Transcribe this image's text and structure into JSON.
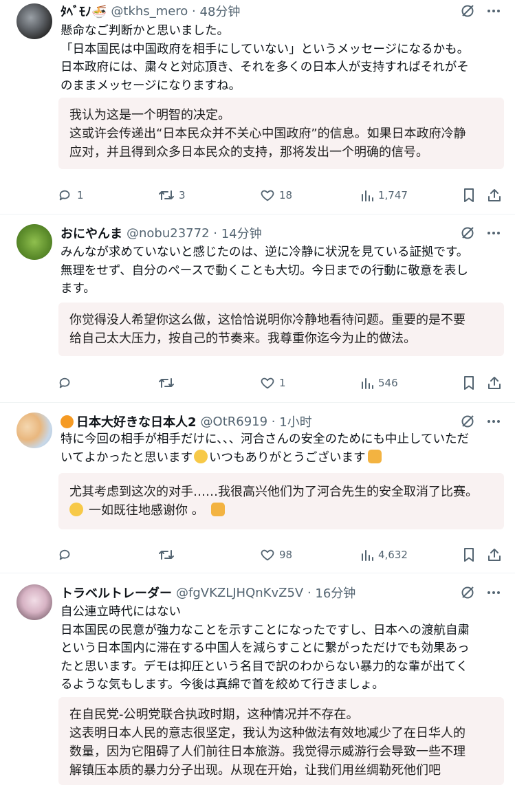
{
  "tweets": [
    {
      "name": "ﾀﾍﾞﾓﾉ🍜",
      "handle": "@tkhs_mero",
      "time": "48分钟",
      "lines": [
        "懸命なご判断かと思いました。",
        "「日本国民は中国政府を相手にしていない」というメッセージになるかも。",
        "日本政府には、粛々と対応頂き、それを多くの日本人が支持すればそれがそ",
        "のままメッセージになりますね。"
      ],
      "translation": [
        "我认为这是一个明智的决定。",
        "这或许会传递出“日本民众并不关心中国政府”的信息。如果日本政府冷静",
        "应对，并且得到众多日本民众的支持，那将发出一个明确的信号。"
      ],
      "replies": "1",
      "retweets": "3",
      "likes": "18",
      "views": "1,747"
    },
    {
      "name": "おにやんま",
      "handle": "@nobu23772",
      "time": "14分钟",
      "lines": [
        "みんなが求めていないと感じたのは、逆に冷静に状況を見ている証拠です。",
        "無理をせず、自分のペースで動くことも大切。今日までの行動に敬意を表し",
        "ます。"
      ],
      "translation": [
        "你觉得没人希望你这么做，这恰恰说明你冷静地看待问题。重要的是不要",
        "给自己太大压力，按自己的节奏来。我尊重你迄今为止的做法。"
      ],
      "replies": "",
      "retweets": "",
      "likes": "1",
      "views": "546"
    },
    {
      "name": "日本大好きな日本人2",
      "handle": "@OtR6919",
      "time": "1小时",
      "lines": [
        "特に今回の相手が相手だけに、、、河合さんの安全のためにも中止していただ",
        "いてよかったと思います",
        "いつもありがとうございます"
      ],
      "translation": [
        "尤其考虑到这次的对手……我很高兴他们为了河合先生的安全取消了比赛。",
        "一如既往地感谢你 。"
      ],
      "replies": "",
      "retweets": "",
      "likes": "98",
      "views": "4,632"
    },
    {
      "name": "トラベルトレーダー",
      "handle": "@fgVKZLJHQnKvZ5V",
      "time": "16分钟",
      "lines": [
        "自公連立時代にはない",
        "日本国民の民意が強力なことを示すことになったですし、日本への渡航自粛",
        "という日本国内に滞在する中国人を減らすことに繋がっただけでも効果あっ",
        "たと思います。デモは抑圧という名目で訳のわからない暴力的な輩が出てく",
        "るような気もします。今後は真綿で首を絞めて行きましょ。"
      ],
      "translation": [
        "在自民党-公明党联合执政时期，这种情况并不存在。",
        "这表明日本人民的意志很坚定，我认为这种做法有效地减少了在日华人的",
        "数量，因为它阻碍了人们前往日本旅游。我觉得示威游行会导致一些不理",
        "解镇压本质的暴力分子出现。从现在开始，让我们用丝绸勒死他们吧"
      ]
    }
  ],
  "colors": {
    "meta": "#536471",
    "translation_bg": "#f9f2f2",
    "divider": "#eff3f4"
  }
}
